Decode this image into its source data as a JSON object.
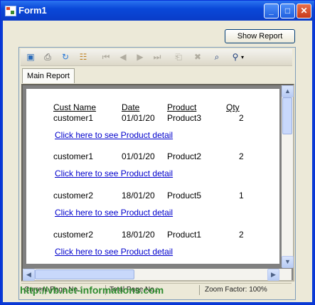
{
  "window": {
    "title": "Form1"
  },
  "controls": {
    "show_report": "Show Report"
  },
  "toolbar": {
    "icons": [
      "export-icon",
      "print-icon",
      "refresh-icon",
      "tree-icon",
      "first-page-icon",
      "prev-page-icon",
      "next-page-icon",
      "last-page-icon",
      "goto-page-icon",
      "stop-icon",
      "search-icon",
      "zoom-icon"
    ]
  },
  "tabs": [
    {
      "label": "Main Report"
    }
  ],
  "report": {
    "headers": {
      "cust": "Cust Name",
      "date": "Date",
      "product": "Product",
      "qty": "Qty"
    },
    "rows": [
      {
        "cust": "customer1",
        "date": "01/01/20",
        "product": "Product3",
        "qty": "2",
        "link": "Click here to see Product detail"
      },
      {
        "cust": "customer1",
        "date": "01/01/20",
        "product": "Product2",
        "qty": "2",
        "link": "Click here to see Product detail"
      },
      {
        "cust": "customer2",
        "date": "18/01/20",
        "product": "Product5",
        "qty": "1",
        "link": "Click here to see Product detail"
      },
      {
        "cust": "customer2",
        "date": "18/01/20",
        "product": "Product1",
        "qty": "2",
        "link": "Click here to see Product detail"
      }
    ]
  },
  "statusbar": {
    "current_page": "Current Page No.: ",
    "total_pages": "Total Page No.: ",
    "zoom": "Zoom Factor: 100%"
  },
  "watermark": "http://vb.net-informations.com"
}
